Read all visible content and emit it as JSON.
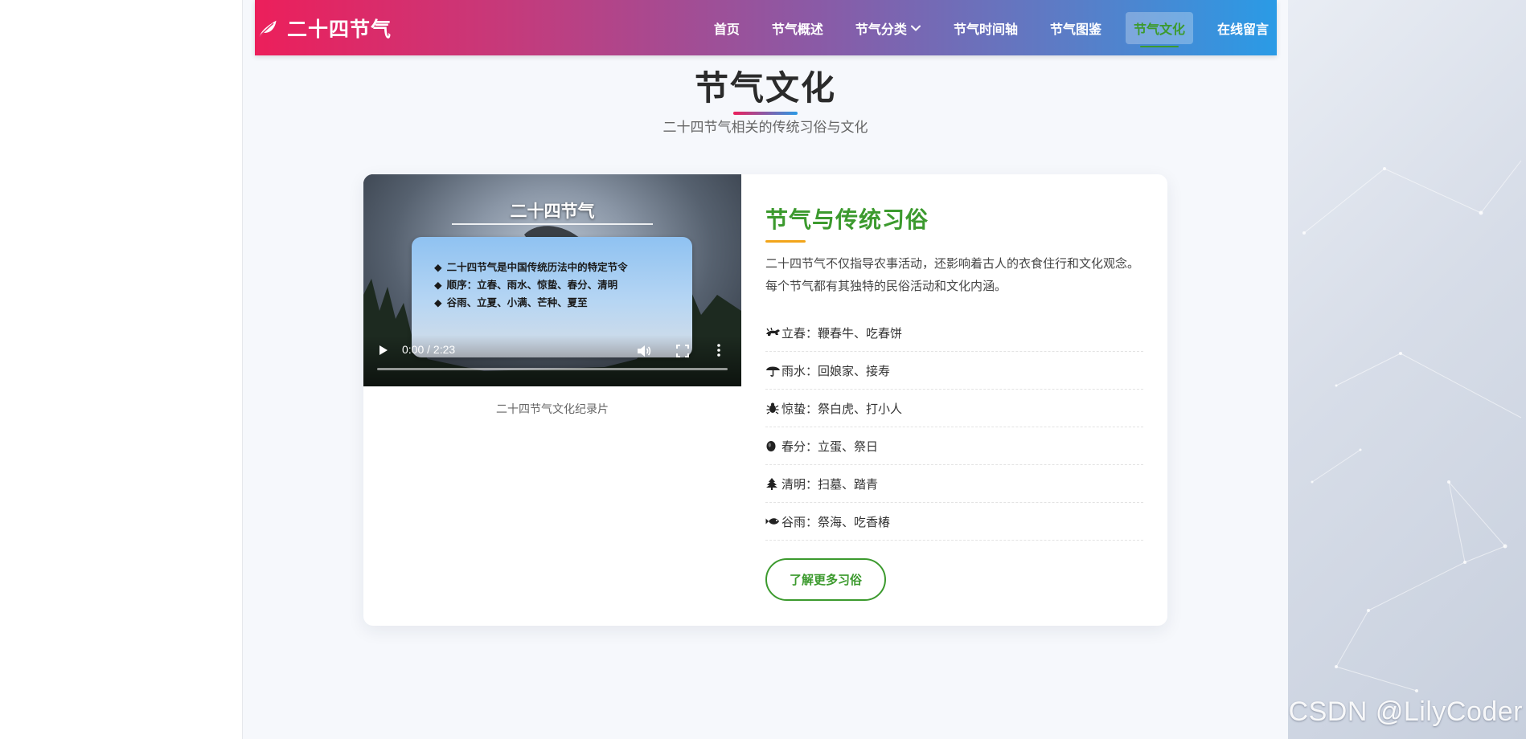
{
  "brand": {
    "title": "二十四节气",
    "icon": "leaf-icon"
  },
  "nav": {
    "items": [
      {
        "label": "首页"
      },
      {
        "label": "节气概述"
      },
      {
        "label": "节气分类",
        "has_dropdown": true
      },
      {
        "label": "节气时间轴"
      },
      {
        "label": "节气图鉴"
      },
      {
        "label": "节气文化",
        "active": true
      },
      {
        "label": "在线留言"
      }
    ]
  },
  "section": {
    "title": "节气文化",
    "subtitle": "二十四节气相关的传统习俗与文化"
  },
  "video": {
    "overlay_title": "二十四节气",
    "overlay_lines": [
      "二十四节气是中国传统历法中的特定节令",
      "顺序：立春、雨水、惊蛰、春分、清明",
      "谷雨、立夏、小满、芒种、夏至"
    ],
    "time": "0:00 / 2:23",
    "progress": 0,
    "caption": "二十四节气文化纪录片"
  },
  "content": {
    "title": "节气与传统习俗",
    "description": "二十四节气不仅指导农事活动，还影响着古人的衣食住行和文化观念。每个节气都有其独特的民俗活动和文化内涵。",
    "customs": [
      {
        "icon": "ox-icon",
        "text": "立春：鞭春牛、吃春饼"
      },
      {
        "icon": "umbrella-icon",
        "text": "雨水：回娘家、接寿"
      },
      {
        "icon": "bug-icon",
        "text": "惊蛰：祭白虎、打小人"
      },
      {
        "icon": "egg-icon",
        "text": "春分：立蛋、祭日"
      },
      {
        "icon": "tree-icon",
        "text": "清明：扫墓、踏青"
      },
      {
        "icon": "fish-icon",
        "text": "谷雨：祭海、吃香椿"
      }
    ],
    "more_button": "了解更多习俗"
  },
  "watermark": "CSDN @LilyCoder",
  "colors": {
    "accent_green": "#3c9a2e",
    "accent_orange": "#f2a51a",
    "nav_gradient_start": "#ec1f5b",
    "nav_gradient_end": "#2a9be6"
  }
}
